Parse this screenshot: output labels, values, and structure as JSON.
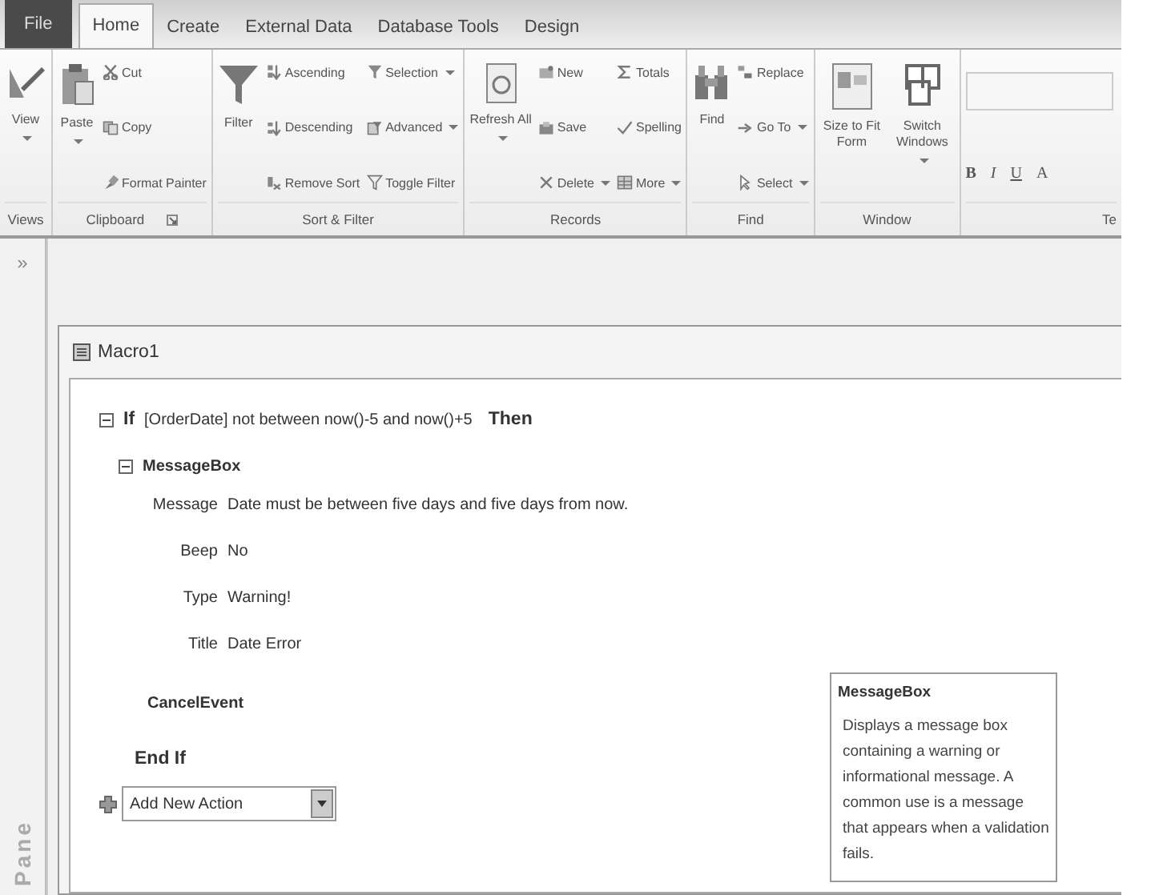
{
  "tabs": [
    {
      "label": "File",
      "kind": "file",
      "selected": false
    },
    {
      "label": "Home",
      "kind": "tab",
      "selected": true
    },
    {
      "label": "Create",
      "kind": "tab",
      "selected": false
    },
    {
      "label": "External Data",
      "kind": "tab",
      "selected": false
    },
    {
      "label": "Database Tools",
      "kind": "tab",
      "selected": false
    },
    {
      "label": "Design",
      "kind": "tab",
      "selected": false
    }
  ],
  "ribbon": {
    "groups": [
      {
        "label": "Views",
        "columns": [
          [
            {
              "label": "View",
              "kind": "large",
              "menu": true
            }
          ]
        ]
      },
      {
        "label": "Clipboard",
        "launcher": true,
        "columns": [
          [
            {
              "label": "Paste",
              "kind": "large",
              "menu": true
            }
          ],
          [
            {
              "label": "Cut",
              "kind": "small",
              "menu": false
            },
            {
              "label": "Copy",
              "kind": "small",
              "menu": false
            },
            {
              "label": "Format Painter",
              "kind": "small",
              "menu": false
            }
          ]
        ]
      },
      {
        "label": "Sort & Filter",
        "columns": [
          [
            {
              "label": "Filter",
              "kind": "large",
              "menu": false
            }
          ],
          [
            {
              "label": "Ascending",
              "kind": "small",
              "menu": false
            },
            {
              "label": "Descending",
              "kind": "small",
              "menu": false
            },
            {
              "label": "Remove Sort",
              "kind": "small",
              "menu": false
            }
          ],
          [
            {
              "label": "Selection",
              "kind": "small",
              "menu": true
            },
            {
              "label": "Advanced",
              "kind": "small",
              "menu": true
            },
            {
              "label": "Toggle Filter",
              "kind": "small",
              "menu": false
            }
          ]
        ]
      },
      {
        "label": "Records",
        "columns": [
          [
            {
              "label": "Refresh All",
              "kind": "large",
              "menu": true
            }
          ],
          [
            {
              "label": "New",
              "kind": "small",
              "menu": false
            },
            {
              "label": "Save",
              "kind": "small",
              "menu": false
            },
            {
              "label": "Delete",
              "kind": "small",
              "menu": true
            }
          ],
          [
            {
              "label": "Totals",
              "kind": "small",
              "menu": false
            },
            {
              "label": "Spelling",
              "kind": "small",
              "menu": false
            },
            {
              "label": "More",
              "kind": "small",
              "menu": true
            }
          ]
        ]
      },
      {
        "label": "Find",
        "columns": [
          [
            {
              "label": "Find",
              "kind": "large",
              "menu": false
            }
          ],
          [
            {
              "label": "Replace",
              "kind": "small",
              "menu": false
            },
            {
              "label": "Go To",
              "kind": "small",
              "menu": true
            },
            {
              "label": "Select",
              "kind": "small",
              "menu": true
            }
          ]
        ]
      },
      {
        "label": "Window",
        "columns": [
          [
            {
              "label": "Size to Fit Form",
              "kind": "large",
              "menu": false
            }
          ],
          [
            {
              "label": "Switch Windows",
              "kind": "large",
              "menu": true
            }
          ]
        ]
      }
    ],
    "text_group": {
      "label": "Te",
      "buttons": [
        "B",
        "I",
        "U",
        "A"
      ]
    }
  },
  "nav_pane": {
    "toggle": "»",
    "label": "Pane"
  },
  "macro": {
    "title": "Macro1",
    "if_block": {
      "keyword": "If",
      "condition": "[OrderDate] not between now()-5 and now()+5",
      "then": "Then",
      "expanded": true,
      "actions": [
        {
          "name": "MessageBox",
          "expanded": true,
          "arguments": [
            {
              "label": "Message",
              "value": "Date must be between five days and five days from now."
            },
            {
              "label": "Beep",
              "value": "No"
            },
            {
              "label": "Type",
              "value": "Warning!"
            },
            {
              "label": "Title",
              "value": "Date Error"
            }
          ]
        },
        {
          "name": "CancelEvent"
        }
      ],
      "end": "End If"
    },
    "add_action": {
      "value": "Add New Action"
    },
    "help": {
      "title": "MessageBox",
      "text": "Displays a message box containing a warning or informational message. A common use is a message that appears when a validation fails."
    }
  }
}
